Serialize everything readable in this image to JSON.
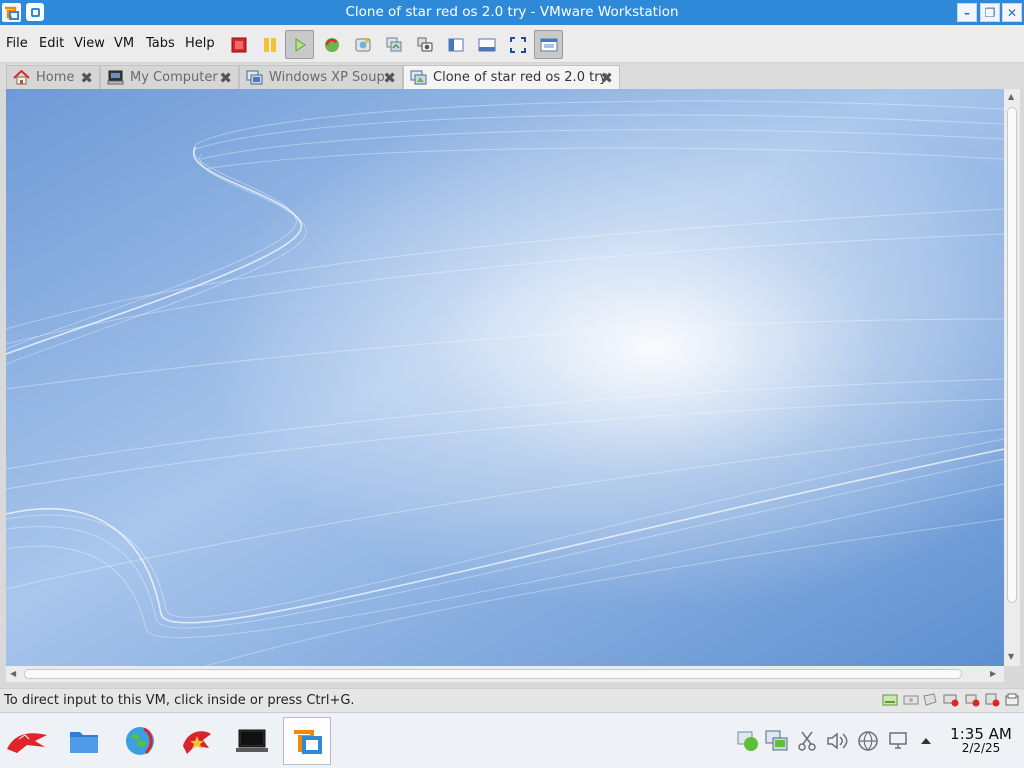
{
  "window": {
    "title": "Clone of star red os 2.0 try - VMware Workstation",
    "minimize_glyph": "–",
    "restore_glyph": "❐",
    "close_glyph": "✕"
  },
  "menu": {
    "items": [
      "File",
      "Edit",
      "View",
      "VM",
      "Tabs",
      "Help"
    ]
  },
  "toolbar": {
    "tools": [
      "power-off-icon",
      "suspend-icon",
      "power-on-icon",
      "revert-snapshot-icon",
      "take-snapshot-icon",
      "snapshot-manager-icon",
      "snapshot-camera-icon",
      "library-view-icon",
      "thumbnail-bar-icon",
      "fullscreen-icon",
      "unity-view-icon"
    ]
  },
  "tabs": [
    {
      "label": "Home",
      "icon": "home-icon",
      "close": "✖",
      "active": false
    },
    {
      "label": "My Computer",
      "icon": "computer-icon",
      "close": "✖",
      "active": false
    },
    {
      "label": "Windows XP Soup",
      "icon": "vm-icon",
      "close": "✖",
      "active": false
    },
    {
      "label": "Clone of star red os 2.0 try",
      "icon": "vm-clone-icon",
      "close": "✖",
      "active": true
    }
  ],
  "status": {
    "hint": "To direct input to this VM, click inside or press Ctrl+G."
  },
  "taskbar": {
    "apps": [
      "start-menu-icon",
      "file-manager-icon",
      "browser-globe-icon",
      "redstar-app-icon",
      "terminal-icon",
      "vmware-workstation-icon"
    ],
    "tray": [
      "network-status-icon",
      "vmware-tray-icon",
      "scissors-icon",
      "volume-icon",
      "globe-network-icon",
      "display-icon",
      "tray-expand-icon"
    ],
    "time": "1:35 AM",
    "date": "2/2/25"
  },
  "colors": {
    "titlebar": "#2e8ad8",
    "wallpaper": "#7fa9dc",
    "taskbar": "#eef1f5"
  }
}
